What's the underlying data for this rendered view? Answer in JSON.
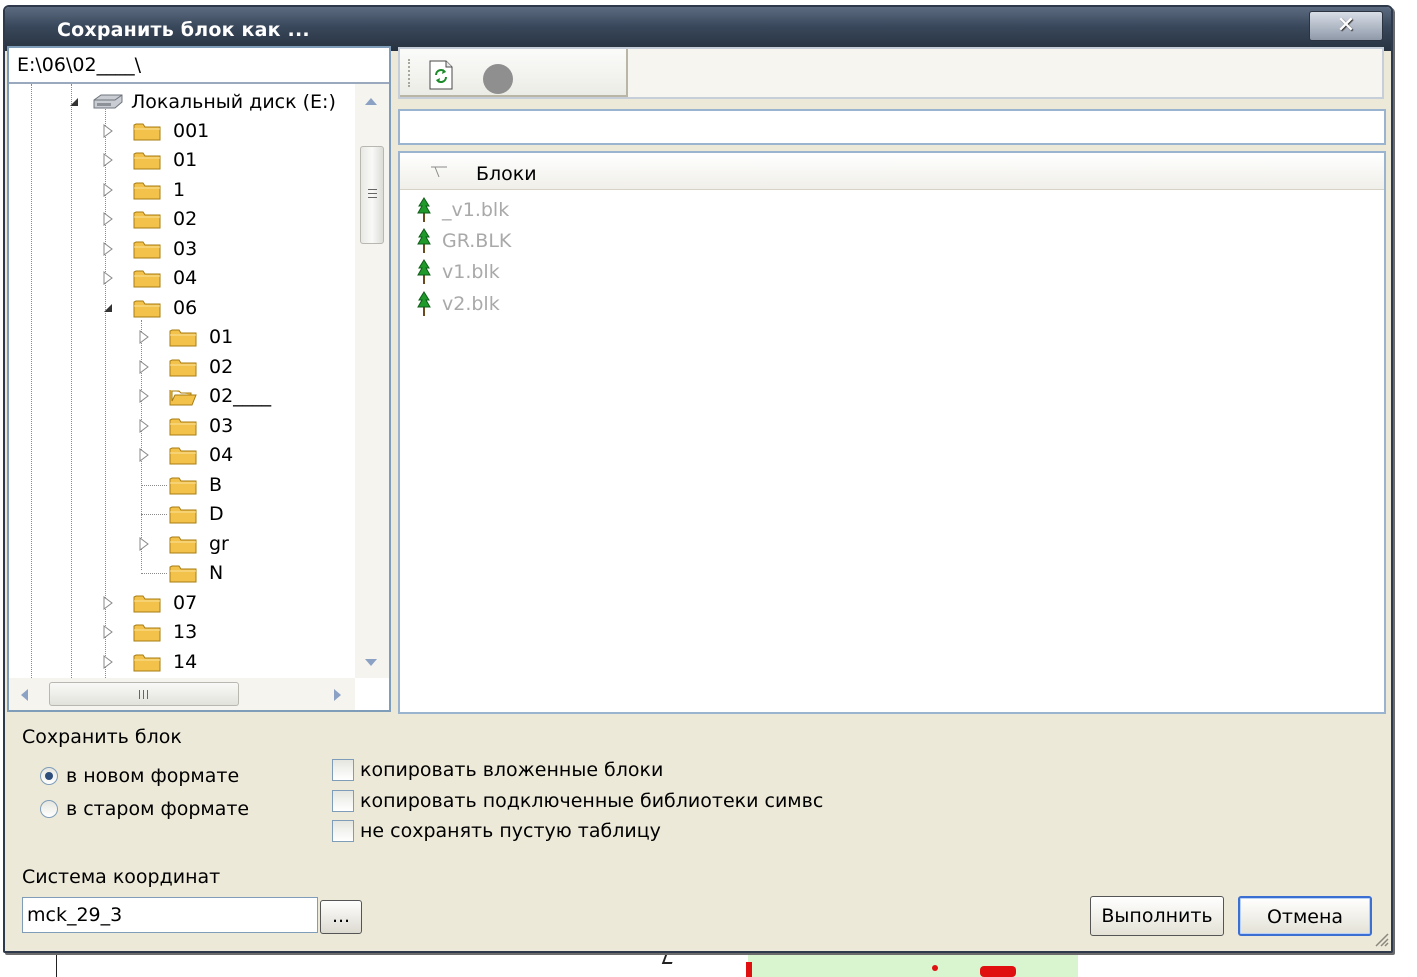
{
  "window": {
    "title": "Сохранить блок как ...",
    "close_symbol": "✕"
  },
  "left_panel": {
    "path": "E:\\06\\02____\\",
    "tree": [
      {
        "label": "Локальный диск (E:)",
        "icon": "drive-icon",
        "expanded": true
      },
      {
        "label": "001",
        "icon": "folder-icon"
      },
      {
        "label": "01",
        "icon": "folder-icon"
      },
      {
        "label": "1",
        "icon": "folder-icon"
      },
      {
        "label": "02",
        "icon": "folder-icon"
      },
      {
        "label": "03",
        "icon": "folder-icon"
      },
      {
        "label": "04",
        "icon": "folder-icon"
      },
      {
        "label": "06",
        "icon": "folder-icon",
        "expanded": true
      },
      {
        "label": "01",
        "icon": "folder-icon"
      },
      {
        "label": "02",
        "icon": "folder-icon"
      },
      {
        "label": "02____",
        "icon": "folder-icon"
      },
      {
        "label": "03",
        "icon": "folder-icon"
      },
      {
        "label": "04",
        "icon": "folder-icon"
      },
      {
        "label": "B",
        "icon": "folder-icon"
      },
      {
        "label": "D",
        "icon": "folder-icon"
      },
      {
        "label": "gr",
        "icon": "folder-icon"
      },
      {
        "label": "N",
        "icon": "folder-icon"
      },
      {
        "label": "07",
        "icon": "folder-icon"
      },
      {
        "label": "13",
        "icon": "folder-icon"
      },
      {
        "label": "14",
        "icon": "folder-icon"
      }
    ]
  },
  "toolbar": {
    "refresh_icon": "refresh-icon",
    "stop_icon": "stop-icon"
  },
  "filter": {
    "value": ""
  },
  "file_list": {
    "column_header": "Блоки",
    "items": [
      "_v1.blk",
      "GR.BLK",
      "v1.blk",
      "v2.blk"
    ],
    "item_icon": "tree-icon"
  },
  "save_block": {
    "group_label": "Сохранить блок",
    "options": [
      {
        "label": "в новом формате",
        "checked": true
      },
      {
        "label": "в старом формате",
        "checked": false
      }
    ],
    "checkboxes": [
      {
        "label": "копировать вложенные блоки",
        "checked": false
      },
      {
        "label": "копировать подключенные библиотеки симвс",
        "checked": false
      },
      {
        "label": "не сохранять пустую таблицу",
        "checked": false
      }
    ]
  },
  "coordinates": {
    "label": "Система координат",
    "value": "mck_29_3",
    "browse_label": "..."
  },
  "buttons": {
    "run": "Выполнить",
    "cancel": "Отмена"
  },
  "colors": {
    "title_bar": "#39475b",
    "dialog_bg": "#ece9d8",
    "folder": "#f3c24a",
    "accent": "#3c6fd2"
  }
}
